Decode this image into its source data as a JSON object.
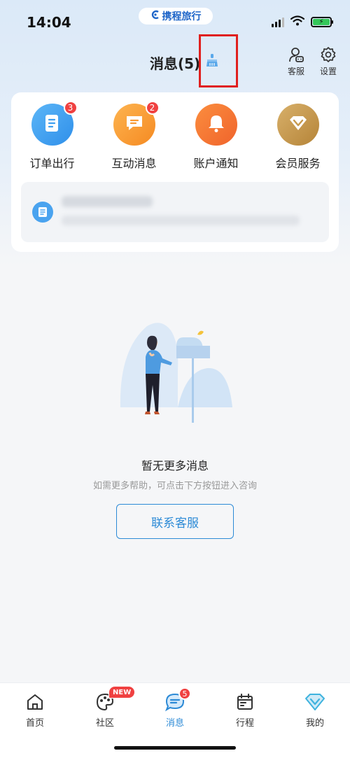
{
  "status_bar": {
    "time": "14:04",
    "brand": "携程旅行"
  },
  "header": {
    "title": "消息(5)",
    "actions": [
      {
        "label": "客服",
        "icon": "customer-service-icon"
      },
      {
        "label": "设置",
        "icon": "gear-icon"
      }
    ]
  },
  "categories": [
    {
      "label": "订单出行",
      "badge": "3",
      "icon": "document-icon",
      "color": "#3f9ff0"
    },
    {
      "label": "互动消息",
      "badge": "2",
      "icon": "chat-bubble-icon",
      "color": "#f99a34"
    },
    {
      "label": "账户通知",
      "badge": "",
      "icon": "bell-icon",
      "color": "#f5753a"
    },
    {
      "label": "会员服务",
      "badge": "",
      "icon": "diamond-icon",
      "color": "#c79a4e"
    }
  ],
  "empty_state": {
    "title": "暂无更多消息",
    "subtitle": "如需更多帮助，可点击下方按钮进入咨询",
    "button": "联系客服"
  },
  "tabs": [
    {
      "label": "首页",
      "icon": "home-icon",
      "badge": "",
      "active": false
    },
    {
      "label": "社区",
      "icon": "palette-icon",
      "badge": "NEW",
      "active": false
    },
    {
      "label": "消息",
      "icon": "message-icon",
      "badge": "5",
      "active": true
    },
    {
      "label": "行程",
      "icon": "calendar-icon",
      "badge": "",
      "active": false
    },
    {
      "label": "我的",
      "icon": "diamond-icon",
      "badge": "",
      "active": false
    }
  ],
  "colors": {
    "accent": "#2c8ad6",
    "badge": "#f04141",
    "highlight": "#e0201e"
  }
}
